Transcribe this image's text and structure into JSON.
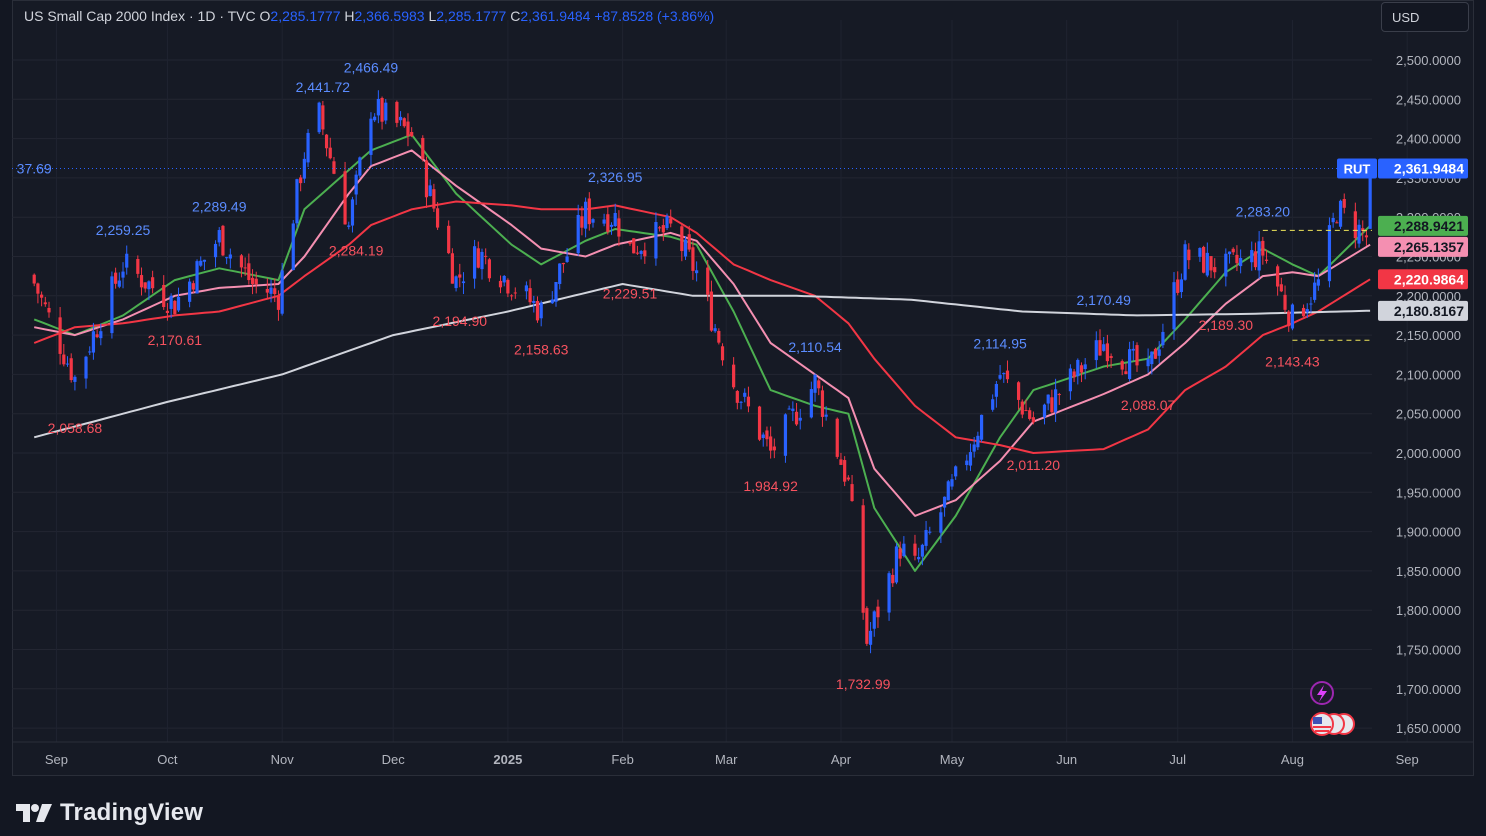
{
  "header": {
    "symbol_name": "US Small Cap 2000 Index · 1D · TVC",
    "o_label": "O",
    "o_value": "2,285.1777",
    "h_label": "H",
    "h_value": "2,366.5983",
    "l_label": "L",
    "l_value": "2,285.1777",
    "c_label": "C",
    "c_value": "2,361.9484",
    "change": "+87.8528 (+3.86%)"
  },
  "currency_button": "USD",
  "footer": {
    "brand": "TradingView"
  },
  "colors": {
    "background": "#161a25",
    "up": "#2962ff",
    "down": "#f23645",
    "ma_fast": "#4caf50",
    "ma_mid": "#f48fb1",
    "ma_slow": "#f23645",
    "ma_long": "#d1d4dc",
    "accent_purple": "#9c27b0"
  },
  "chart_data": {
    "type": "candlestick",
    "symbol": "RUT",
    "x_ticks": [
      "Sep",
      "Oct",
      "Nov",
      "Dec",
      "2025",
      "Feb",
      "Mar",
      "Apr",
      "May",
      "Jun",
      "Jul",
      "Aug",
      "Sep"
    ],
    "y_ticks": [
      "2,500.0000",
      "2,450.0000",
      "2,400.0000",
      "2,350.0000",
      "2,300.0000",
      "2,250.0000",
      "2,200.0000",
      "2,150.0000",
      "2,100.0000",
      "2,050.0000",
      "2,000.0000",
      "1,950.0000",
      "1,900.0000",
      "1,850.0000",
      "1,800.0000",
      "1,750.0000",
      "1,700.0000",
      "1,650.0000"
    ],
    "y_range": [
      1640,
      2530
    ],
    "scale_labels": [
      {
        "name": "RUT",
        "value": "2,361.9484",
        "price": 2361.9484,
        "color": "#2962ff"
      },
      {
        "value": "2,288.9421",
        "price": 2288.9421,
        "color": "#4caf50"
      },
      {
        "value": "2,265.1357",
        "price": 2265.1357,
        "color": "#f48fb1"
      },
      {
        "value": "2,220.9864",
        "price": 2220.9864,
        "color": "#f23645"
      },
      {
        "value": "2,180.8167",
        "price": 2180.8167,
        "color": "#d1d4dc"
      }
    ],
    "annotations": [
      {
        "text": "37.69",
        "date": "2024-08-26",
        "price": 2337.69,
        "kind": "high"
      },
      {
        "text": "2,259.25",
        "date": "2024-09-19",
        "price": 2259.25,
        "kind": "high"
      },
      {
        "text": "2,058.68",
        "date": "2024-09-06",
        "price": 2058.68,
        "kind": "low"
      },
      {
        "text": "2,170.61",
        "date": "2024-10-03",
        "price": 2170.61,
        "kind": "low"
      },
      {
        "text": "2,289.49",
        "date": "2024-10-15",
        "price": 2289.49,
        "kind": "high"
      },
      {
        "text": "2,441.72",
        "date": "2024-11-12",
        "price": 2441.72,
        "kind": "high"
      },
      {
        "text": "2,466.49",
        "date": "2024-11-25",
        "price": 2466.49,
        "kind": "high"
      },
      {
        "text": "2,284.19",
        "date": "2024-11-21",
        "price": 2284.19,
        "kind": "low"
      },
      {
        "text": "2,194.90",
        "date": "2024-12-19",
        "price": 2194.9,
        "kind": "low"
      },
      {
        "text": "2,158.63",
        "date": "2025-01-10",
        "price": 2158.63,
        "kind": "low"
      },
      {
        "text": "2,326.95",
        "date": "2025-01-30",
        "price": 2326.95,
        "kind": "high"
      },
      {
        "text": "2,229.51",
        "date": "2025-02-03",
        "price": 2229.51,
        "kind": "low"
      },
      {
        "text": "2,110.54",
        "date": "2025-03-25",
        "price": 2110.54,
        "kind": "high"
      },
      {
        "text": "1,984.92",
        "date": "2025-03-13",
        "price": 1984.92,
        "kind": "low"
      },
      {
        "text": "1,732.99",
        "date": "2025-04-07",
        "price": 1732.99,
        "kind": "low"
      },
      {
        "text": "2,114.95",
        "date": "2025-05-14",
        "price": 2114.95,
        "kind": "high"
      },
      {
        "text": "2,011.20",
        "date": "2025-05-23",
        "price": 2011.2,
        "kind": "low"
      },
      {
        "text": "2,170.49",
        "date": "2025-06-11",
        "price": 2170.49,
        "kind": "high"
      },
      {
        "text": "2,088.07",
        "date": "2025-06-23",
        "price": 2088.07,
        "kind": "low"
      },
      {
        "text": "2,283.20",
        "date": "2025-07-24",
        "price": 2283.2,
        "kind": "high"
      },
      {
        "text": "2,189.30",
        "date": "2025-07-14",
        "price": 2189.3,
        "kind": "low"
      },
      {
        "text": "2,143.43",
        "date": "2025-08-01",
        "price": 2143.43,
        "kind": "low"
      }
    ],
    "price_path": [
      [
        "2024-08-26",
        2216
      ],
      [
        "2024-09-06",
        2095
      ],
      [
        "2024-09-19",
        2240
      ],
      [
        "2024-10-03",
        2190
      ],
      [
        "2024-10-15",
        2275
      ],
      [
        "2024-10-24",
        2215
      ],
      [
        "2024-10-31",
        2200
      ],
      [
        "2024-11-07",
        2382
      ],
      [
        "2024-11-11",
        2430
      ],
      [
        "2024-11-19",
        2288
      ],
      [
        "2024-11-25",
        2440
      ],
      [
        "2024-12-06",
        2405
      ],
      [
        "2024-12-18",
        2220
      ],
      [
        "2024-12-24",
        2255
      ],
      [
        "2025-01-10",
        2180
      ],
      [
        "2025-01-22",
        2305
      ],
      [
        "2025-01-30",
        2300
      ],
      [
        "2025-02-03",
        2260
      ],
      [
        "2025-02-14",
        2285
      ],
      [
        "2025-02-21",
        2230
      ],
      [
        "2025-03-03",
        2090
      ],
      [
        "2025-03-13",
        2000
      ],
      [
        "2025-03-25",
        2090
      ],
      [
        "2025-04-03",
        1960
      ],
      [
        "2025-04-08",
        1760
      ],
      [
        "2025-04-17",
        1880
      ],
      [
        "2025-04-21",
        1855
      ],
      [
        "2025-05-02",
        1965
      ],
      [
        "2025-05-14",
        2100
      ],
      [
        "2025-05-23",
        2040
      ],
      [
        "2025-06-11",
        2140
      ],
      [
        "2025-06-23",
        2100
      ],
      [
        "2025-07-03",
        2250
      ],
      [
        "2025-07-14",
        2235
      ],
      [
        "2025-07-24",
        2255
      ],
      [
        "2025-08-01",
        2170
      ],
      [
        "2025-08-08",
        2215
      ],
      [
        "2025-08-13",
        2310
      ],
      [
        "2025-08-21",
        2275
      ],
      [
        "2025-08-22",
        2362
      ]
    ],
    "moving_averages": [
      {
        "color": "#4caf50",
        "points": [
          [
            "2024-08-26",
            2170
          ],
          [
            "2024-09-06",
            2150
          ],
          [
            "2024-09-19",
            2175
          ],
          [
            "2024-10-03",
            2220
          ],
          [
            "2024-10-15",
            2235
          ],
          [
            "2024-10-31",
            2220
          ],
          [
            "2024-11-07",
            2310
          ],
          [
            "2024-11-19",
            2360
          ],
          [
            "2024-11-25",
            2385
          ],
          [
            "2024-12-06",
            2405
          ],
          [
            "2024-12-18",
            2330
          ],
          [
            "2025-01-02",
            2265
          ],
          [
            "2025-01-10",
            2240
          ],
          [
            "2025-01-22",
            2270
          ],
          [
            "2025-01-30",
            2285
          ],
          [
            "2025-02-14",
            2275
          ],
          [
            "2025-02-21",
            2265
          ],
          [
            "2025-03-03",
            2180
          ],
          [
            "2025-03-13",
            2080
          ],
          [
            "2025-03-25",
            2060
          ],
          [
            "2025-04-03",
            2050
          ],
          [
            "2025-04-10",
            1930
          ],
          [
            "2025-04-21",
            1850
          ],
          [
            "2025-05-02",
            1920
          ],
          [
            "2025-05-14",
            2020
          ],
          [
            "2025-05-23",
            2080
          ],
          [
            "2025-06-11",
            2110
          ],
          [
            "2025-06-23",
            2120
          ],
          [
            "2025-07-03",
            2170
          ],
          [
            "2025-07-14",
            2230
          ],
          [
            "2025-07-24",
            2260
          ],
          [
            "2025-08-01",
            2240
          ],
          [
            "2025-08-08",
            2225
          ],
          [
            "2025-08-22",
            2289
          ]
        ]
      },
      {
        "color": "#f48fb1",
        "points": [
          [
            "2024-08-26",
            2160
          ],
          [
            "2024-09-06",
            2150
          ],
          [
            "2024-09-19",
            2170
          ],
          [
            "2024-10-03",
            2200
          ],
          [
            "2024-10-15",
            2210
          ],
          [
            "2024-10-31",
            2215
          ],
          [
            "2024-11-07",
            2250
          ],
          [
            "2024-11-19",
            2330
          ],
          [
            "2024-11-25",
            2365
          ],
          [
            "2024-12-06",
            2385
          ],
          [
            "2024-12-18",
            2340
          ],
          [
            "2025-01-02",
            2290
          ],
          [
            "2025-01-10",
            2260
          ],
          [
            "2025-01-22",
            2250
          ],
          [
            "2025-01-30",
            2265
          ],
          [
            "2025-02-14",
            2280
          ],
          [
            "2025-02-21",
            2270
          ],
          [
            "2025-03-03",
            2215
          ],
          [
            "2025-03-13",
            2140
          ],
          [
            "2025-03-25",
            2100
          ],
          [
            "2025-04-03",
            2070
          ],
          [
            "2025-04-10",
            1980
          ],
          [
            "2025-04-21",
            1920
          ],
          [
            "2025-05-02",
            1940
          ],
          [
            "2025-05-14",
            1990
          ],
          [
            "2025-05-23",
            2040
          ],
          [
            "2025-06-11",
            2075
          ],
          [
            "2025-06-23",
            2100
          ],
          [
            "2025-07-03",
            2140
          ],
          [
            "2025-07-14",
            2190
          ],
          [
            "2025-07-24",
            2225
          ],
          [
            "2025-08-01",
            2230
          ],
          [
            "2025-08-08",
            2225
          ],
          [
            "2025-08-22",
            2265
          ]
        ]
      },
      {
        "color": "#f23645",
        "points": [
          [
            "2024-08-26",
            2140
          ],
          [
            "2024-09-06",
            2160
          ],
          [
            "2024-09-19",
            2165
          ],
          [
            "2024-10-03",
            2175
          ],
          [
            "2024-10-15",
            2180
          ],
          [
            "2024-10-31",
            2200
          ],
          [
            "2024-11-07",
            2225
          ],
          [
            "2024-11-19",
            2265
          ],
          [
            "2024-11-25",
            2290
          ],
          [
            "2024-12-06",
            2310
          ],
          [
            "2024-12-18",
            2320
          ],
          [
            "2025-01-02",
            2315
          ],
          [
            "2025-01-10",
            2310
          ],
          [
            "2025-01-22",
            2310
          ],
          [
            "2025-01-30",
            2315
          ],
          [
            "2025-02-14",
            2300
          ],
          [
            "2025-02-21",
            2280
          ],
          [
            "2025-03-03",
            2240
          ],
          [
            "2025-03-13",
            2220
          ],
          [
            "2025-03-25",
            2200
          ],
          [
            "2025-04-03",
            2165
          ],
          [
            "2025-04-10",
            2120
          ],
          [
            "2025-04-21",
            2060
          ],
          [
            "2025-05-02",
            2020
          ],
          [
            "2025-05-14",
            2010
          ],
          [
            "2025-05-23",
            2000
          ],
          [
            "2025-06-11",
            2005
          ],
          [
            "2025-06-23",
            2030
          ],
          [
            "2025-07-03",
            2080
          ],
          [
            "2025-07-14",
            2110
          ],
          [
            "2025-07-24",
            2150
          ],
          [
            "2025-08-01",
            2165
          ],
          [
            "2025-08-08",
            2180
          ],
          [
            "2025-08-22",
            2221
          ]
        ]
      },
      {
        "color": "#d1d4dc",
        "points": [
          [
            "2024-08-26",
            2020
          ],
          [
            "2024-10-01",
            2065
          ],
          [
            "2024-11-01",
            2100
          ],
          [
            "2024-12-01",
            2150
          ],
          [
            "2025-01-01",
            2180
          ],
          [
            "2025-02-01",
            2215
          ],
          [
            "2025-02-20",
            2200
          ],
          [
            "2025-03-20",
            2200
          ],
          [
            "2025-04-20",
            2195
          ],
          [
            "2025-05-20",
            2180
          ],
          [
            "2025-06-20",
            2175
          ],
          [
            "2025-07-20",
            2177
          ],
          [
            "2025-08-22",
            2181
          ]
        ]
      }
    ],
    "reference_lines": [
      {
        "price": 2361.9484,
        "style": "dotted",
        "color": "#2962ff"
      },
      {
        "price": 2283.2,
        "style": "dashed",
        "color": "#f0e65a",
        "from": "2025-07-24"
      },
      {
        "price": 2143.43,
        "style": "dashed",
        "color": "#f0e65a",
        "from": "2025-08-01"
      }
    ]
  }
}
